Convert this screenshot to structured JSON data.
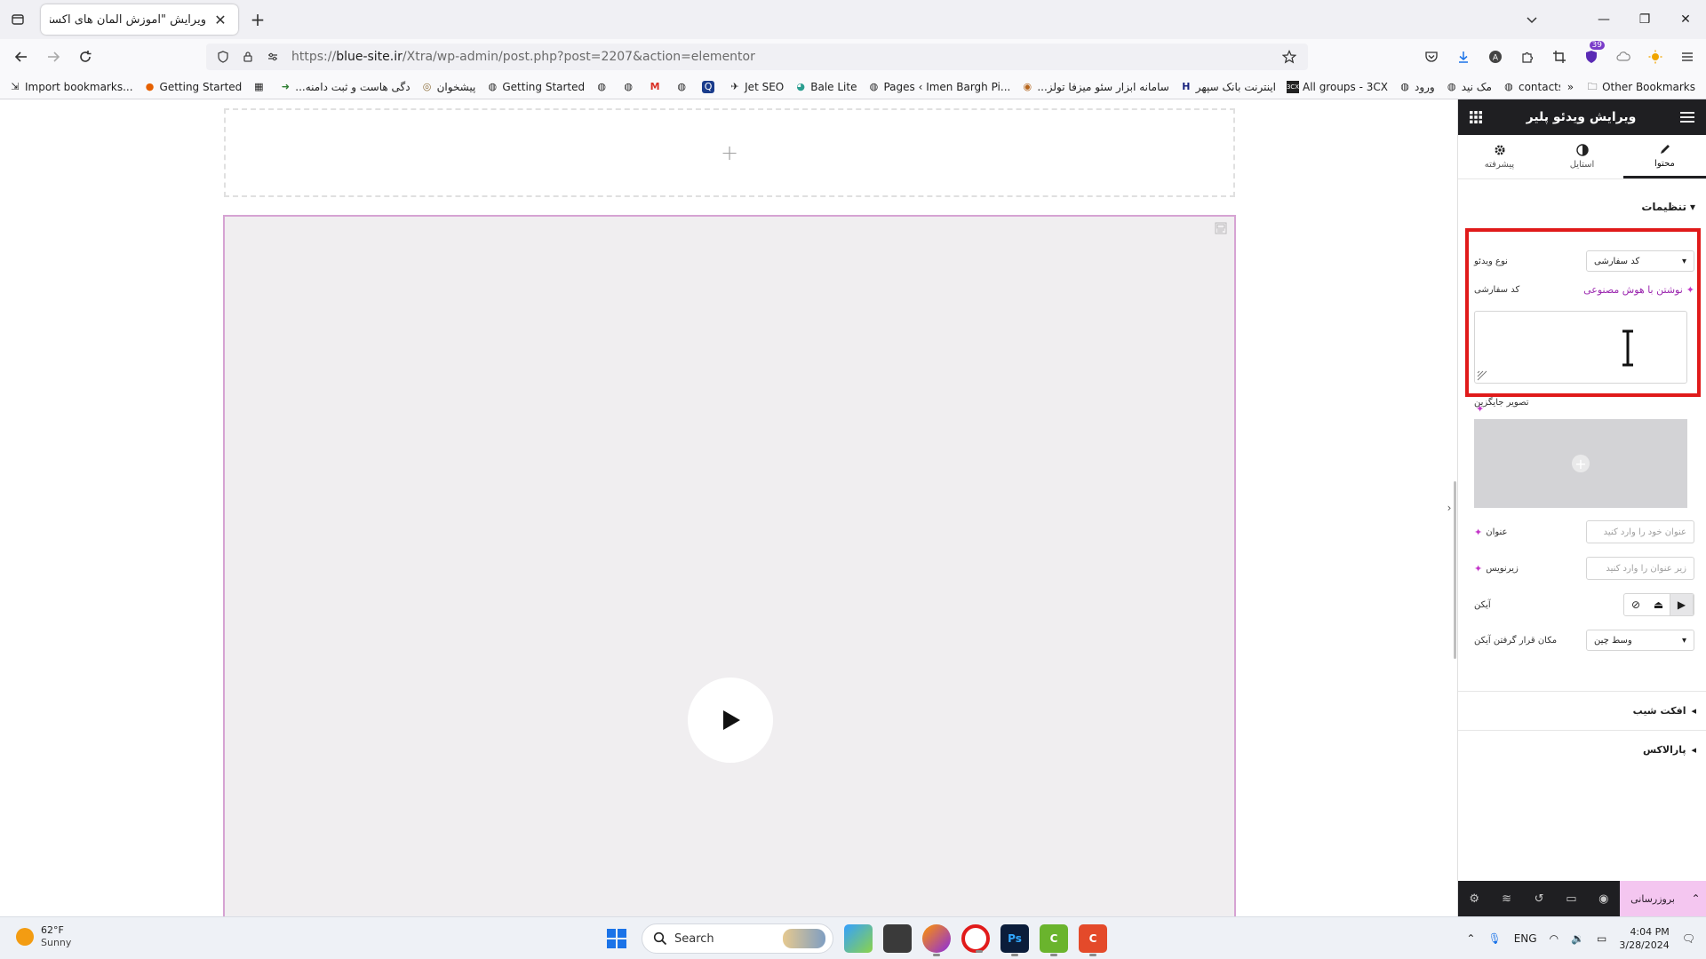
{
  "browser": {
    "tab_title": "ویرایش \"آموزش المان های اکسترا – ...",
    "url_prefix": "https://",
    "url_host": "blue-site.ir",
    "url_path": "/Xtra/wp-admin/post.php?post=2207&action=elementor",
    "extension_badge": "39"
  },
  "bookmarks": {
    "items": [
      {
        "label": "Import bookmarks...",
        "icon": "import-icon"
      },
      {
        "label": "Getting Started",
        "icon": "firefox-icon"
      },
      {
        "label": "",
        "icon": "calendar-icon"
      },
      {
        "label": "...دگی هاست و ثبت دامنه",
        "icon": "arrow-icon"
      },
      {
        "label": "پیشخوان",
        "icon": "wordpress-icon"
      },
      {
        "label": "Getting Started",
        "icon": "globe-icon"
      },
      {
        "label": "",
        "icon": "globe-icon"
      },
      {
        "label": "",
        "icon": "globe-icon"
      },
      {
        "label": "",
        "icon": "gmail-icon"
      },
      {
        "label": "",
        "icon": "globe-icon"
      },
      {
        "label": "",
        "icon": "q-icon"
      },
      {
        "label": "Jet SEO",
        "icon": "rocket-icon"
      },
      {
        "label": "Bale Lite",
        "icon": "bale-icon"
      },
      {
        "label": "Pages ‹ Imen Bargh Pi...",
        "icon": "globe-icon"
      },
      {
        "label": "...سامانه ابزار سئو میزفا تولز",
        "icon": "lion-icon"
      },
      {
        "label": "اینترنت بانک سپهر",
        "icon": "bank-icon"
      },
      {
        "label": "All groups - 3CX",
        "icon": "3cx-icon"
      },
      {
        "label": "ورود",
        "icon": "globe-icon"
      },
      {
        "label": "مک نید",
        "icon": "globe-icon"
      },
      {
        "label": "contacts",
        "icon": "globe-icon"
      }
    ],
    "other": "Other Bookmarks"
  },
  "panel": {
    "title": "ویرایش ویدئو پلیر",
    "tabs": {
      "content": "محتوا",
      "style": "استایل",
      "advanced": "پیشرفته"
    },
    "section_settings": "تنظیمات",
    "video_type_label": "نوع ویدئو",
    "video_type_value": "کد سفارشی",
    "custom_code_label": "کد سفارشی",
    "ai_write": "نوشتن با هوش مصنوعی",
    "placeholder_image_label": "تصویر جایگزین",
    "title_label": "عنوان",
    "title_placeholder": "عنوان خود را وارد کنید",
    "subtitle_label": "زیرنویس",
    "subtitle_placeholder": "زیر عنوان را وارد کنید",
    "icon_label": "آیکن",
    "icon_position_label": "مکان قرار گرفتن آیکن",
    "icon_position_value": "وسط چین",
    "tilt_effect": "افکت شیب",
    "parallax": "پارالاکس",
    "publish": "بروزرسانی"
  },
  "taskbar": {
    "temperature": "62°F",
    "condition": "Sunny",
    "search": "Search",
    "language": "ENG",
    "time": "4:04 PM",
    "date": "3/28/2024"
  }
}
